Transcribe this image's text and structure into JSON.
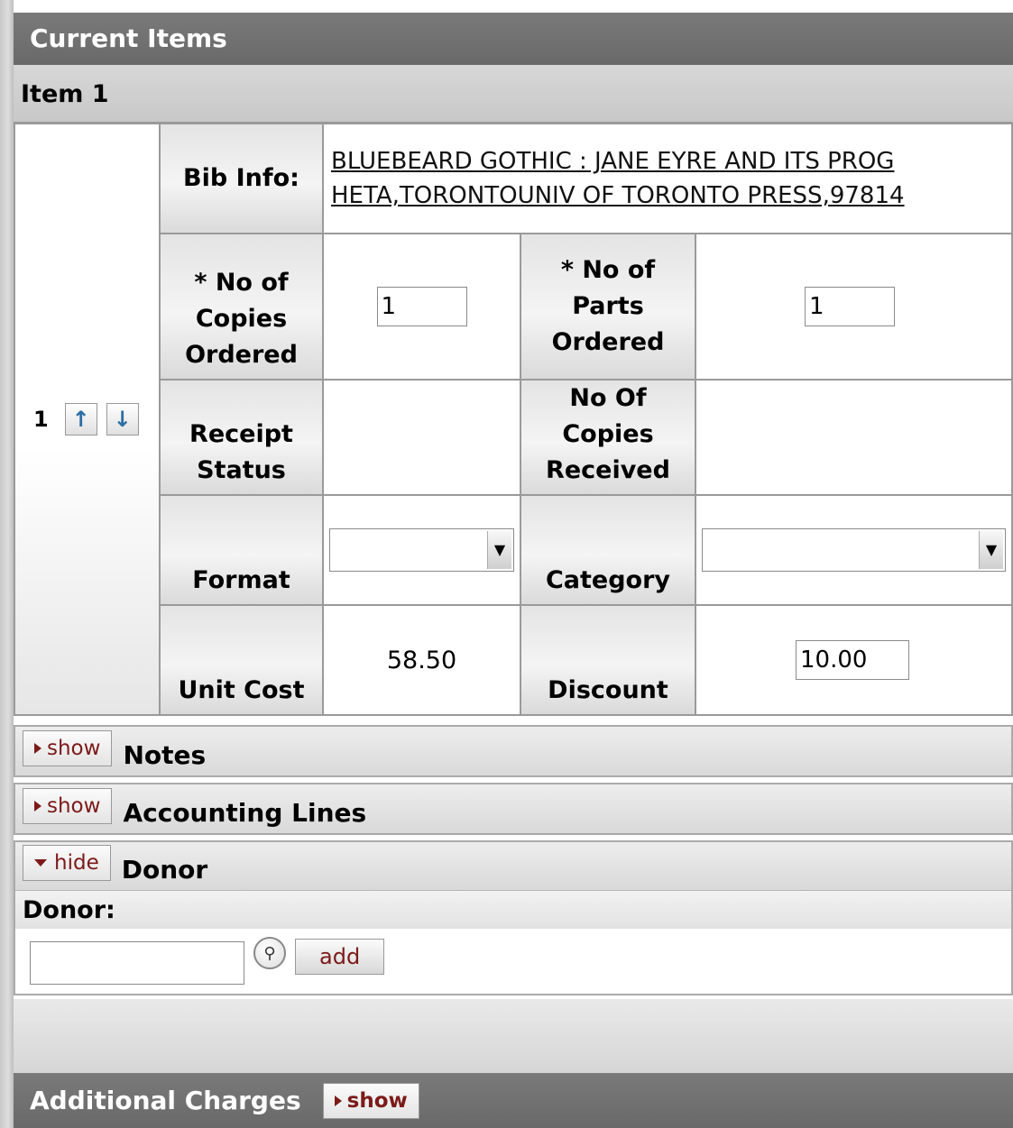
{
  "section_title": "Current Items",
  "item_header": "Item 1",
  "item": {
    "row_number": "1",
    "bib_label": "Bib Info:",
    "bib_line1": "BLUEBEARD GOTHIC : JANE EYRE AND ITS PROG",
    "bib_line2": "HETA,TORONTOUNIV OF TORONTO PRESS,97814",
    "copies_ordered_label": "* No of Copies Ordered",
    "copies_ordered_value": "1",
    "parts_ordered_label": "* No of Parts Ordered",
    "parts_ordered_value": "1",
    "receipt_status_label": "Receipt Status",
    "receipt_status_value": "",
    "copies_received_label": "No Of Copies Received",
    "copies_received_value": "",
    "format_label": "Format",
    "format_value": "",
    "category_label": "Category",
    "category_value": "",
    "unit_cost_label": "Unit Cost",
    "unit_cost_value": "58.50",
    "discount_label": "Discount",
    "discount_value": "10.00"
  },
  "icons": {
    "move_up": "arrow-up-icon",
    "move_down": "arrow-down-icon",
    "lookup": "magnifier-icon"
  },
  "tabs": {
    "notes": {
      "toggle": "show",
      "title": "Notes"
    },
    "accounting": {
      "toggle": "show",
      "title": "Accounting Lines"
    },
    "donor": {
      "toggle": "hide",
      "title": "Donor"
    }
  },
  "donor": {
    "label": "Donor:",
    "input_value": "",
    "add_label": "add"
  },
  "additional_charges": {
    "title": "Additional Charges",
    "toggle": "show"
  },
  "colors": {
    "header_bg": "#6f6f6f",
    "toggle_text": "#7c1a1a",
    "arrow_blue": "#2d6ea3"
  }
}
